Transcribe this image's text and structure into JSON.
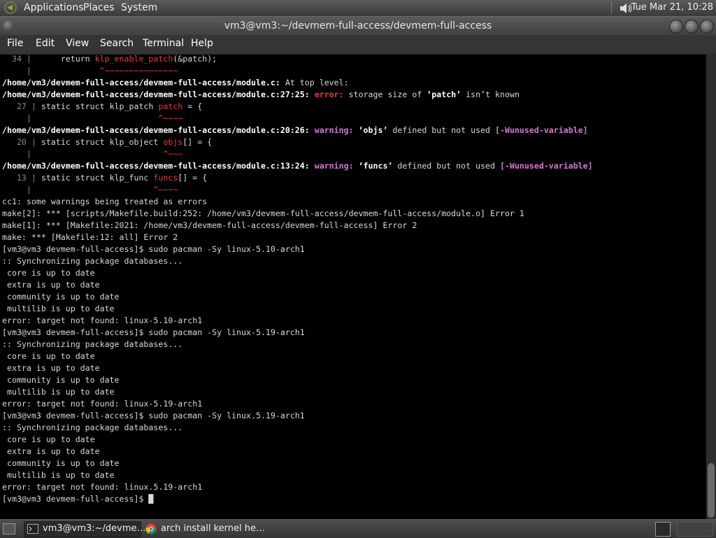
{
  "top_panel": {
    "menus": [
      "Applications",
      "Places",
      "System"
    ],
    "clock": "Tue Mar 21, 10:28",
    "icons": {
      "logo": "gnome-foot-icon",
      "volume": "volume-icon"
    }
  },
  "window": {
    "title": "vm3@vm3:~/devmem-full-access/devmem-full-access"
  },
  "menubar": {
    "file": "File",
    "edit": "Edit",
    "view": "View",
    "search": "Search",
    "terminal": "Terminal",
    "help": "Help"
  },
  "terminal": {
    "lines": [
      [
        [
          "  34 | ",
          "g"
        ],
        [
          "     return ",
          ""
        ],
        [
          "klp_enable_patch",
          "hl"
        ],
        [
          "(&patch);",
          ""
        ]
      ],
      [
        [
          "     | ",
          "g"
        ],
        [
          "             ",
          ""
        ],
        [
          "^~~~~~~~~~~~~~~~",
          "hl"
        ]
      ],
      [
        [
          "/home/vm3/devmem-full-access/devmem-full-access/module.c:",
          "b"
        ],
        [
          " At top level:",
          ""
        ]
      ],
      [
        [
          "/home/vm3/devmem-full-access/devmem-full-access/module.c:27:25: ",
          "b"
        ],
        [
          "error: ",
          "r"
        ],
        [
          "storage size of ",
          ""
        ],
        [
          "‘patch’",
          "b"
        ],
        [
          " isn’t known",
          ""
        ]
      ],
      [
        [
          "   27 | ",
          "g"
        ],
        [
          "static struct klp_patch ",
          ""
        ],
        [
          "patch",
          "hl"
        ],
        [
          " = {",
          ""
        ]
      ],
      [
        [
          "     | ",
          "g"
        ],
        [
          "                         ",
          ""
        ],
        [
          "^~~~~",
          "hl"
        ]
      ],
      [
        [
          "/home/vm3/devmem-full-access/devmem-full-access/module.c:20:26: ",
          "b"
        ],
        [
          "warning: ",
          "m"
        ],
        [
          "‘objs’",
          "b"
        ],
        [
          " defined but not used ",
          ""
        ],
        [
          "[-Wunused-variable]",
          "m"
        ]
      ],
      [
        [
          "   20 | ",
          "g"
        ],
        [
          "static struct klp_object ",
          ""
        ],
        [
          "objs",
          "hl"
        ],
        [
          "[] = {",
          ""
        ]
      ],
      [
        [
          "     | ",
          "g"
        ],
        [
          "                          ",
          ""
        ],
        [
          "^~~~",
          "hl"
        ]
      ],
      [
        [
          "/home/vm3/devmem-full-access/devmem-full-access/module.c:13:24: ",
          "b"
        ],
        [
          "warning: ",
          "m"
        ],
        [
          "‘funcs’",
          "b"
        ],
        [
          " defined but not used ",
          ""
        ],
        [
          "[-Wunused-variable]",
          "m"
        ]
      ],
      [
        [
          "   13 | ",
          "g"
        ],
        [
          "static struct klp_func ",
          ""
        ],
        [
          "funcs",
          "hl"
        ],
        [
          "[] = {",
          ""
        ]
      ],
      [
        [
          "     | ",
          "g"
        ],
        [
          "                        ",
          ""
        ],
        [
          "^~~~~",
          "hl"
        ]
      ],
      [
        [
          "cc1: some warnings being treated as errors",
          ""
        ]
      ],
      [
        [
          "make[2]: *** [scripts/Makefile.build:252: /home/vm3/devmem-full-access/devmem-full-access/module.o] Error 1",
          ""
        ]
      ],
      [
        [
          "make[1]: *** [Makefile:2021: /home/vm3/devmem-full-access/devmem-full-access] Error 2",
          ""
        ]
      ],
      [
        [
          "make: *** [Makefile:12: all] Error 2",
          ""
        ]
      ],
      [
        [
          "[vm3@vm3 devmem-full-access]$ sudo pacman -Sy linux-5.10-arch1",
          ""
        ]
      ],
      [
        [
          ":: Synchronizing package databases...",
          ""
        ]
      ],
      [
        [
          " core is up to date",
          ""
        ]
      ],
      [
        [
          " extra is up to date",
          ""
        ]
      ],
      [
        [
          " community is up to date",
          ""
        ]
      ],
      [
        [
          " multilib is up to date",
          ""
        ]
      ],
      [
        [
          "error: target not found: linux-5.10-arch1",
          ""
        ]
      ],
      [
        [
          "[vm3@vm3 devmem-full-access]$ sudo pacman -Sy linux-5.19-arch1",
          ""
        ]
      ],
      [
        [
          ":: Synchronizing package databases...",
          ""
        ]
      ],
      [
        [
          " core is up to date",
          ""
        ]
      ],
      [
        [
          " extra is up to date",
          ""
        ]
      ],
      [
        [
          " community is up to date",
          ""
        ]
      ],
      [
        [
          " multilib is up to date",
          ""
        ]
      ],
      [
        [
          "error: target not found: linux-5.19-arch1",
          ""
        ]
      ],
      [
        [
          "[vm3@vm3 devmem-full-access]$ sudo pacman -Sy linux.5.19-arch1",
          ""
        ]
      ],
      [
        [
          ":: Synchronizing package databases...",
          ""
        ]
      ],
      [
        [
          " core is up to date",
          ""
        ]
      ],
      [
        [
          " extra is up to date",
          ""
        ]
      ],
      [
        [
          " community is up to date",
          ""
        ]
      ],
      [
        [
          " multilib is up to date",
          ""
        ]
      ],
      [
        [
          "error: target not found: linux.5.19-arch1",
          ""
        ]
      ],
      [
        [
          "[vm3@vm3 devmem-full-access]$ ",
          ""
        ],
        [
          "█",
          ""
        ]
      ]
    ]
  },
  "taskbar": {
    "tasks": [
      {
        "label": "vm3@vm3:~/devme…",
        "icon": "terminal-icon"
      },
      {
        "label": "arch install kernel he…",
        "icon": "chrome-icon"
      }
    ],
    "icons": {
      "show_desktop": "show-desktop-icon",
      "tray_terminal": "terminal-icon"
    }
  },
  "colors": {
    "error": "#e43b3b",
    "warning": "#cf7bcf",
    "background": "#000000",
    "panel": "#4a4a4a"
  }
}
